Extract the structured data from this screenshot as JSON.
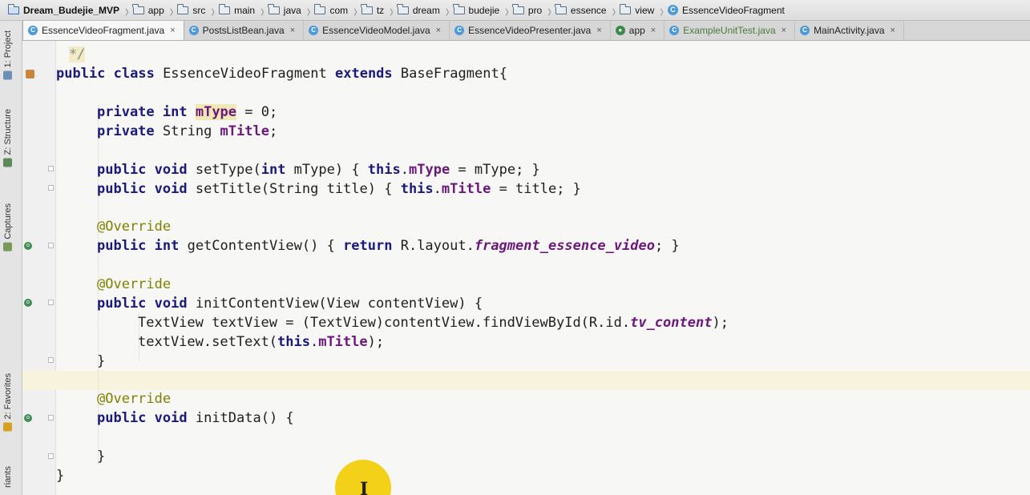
{
  "breadcrumb": [
    {
      "label": "Dream_Budejie_MVP",
      "icon": "project-folder-icon"
    },
    {
      "label": "app",
      "icon": "module-folder-icon"
    },
    {
      "label": "src",
      "icon": "folder-icon"
    },
    {
      "label": "main",
      "icon": "folder-icon"
    },
    {
      "label": "java",
      "icon": "folder-icon"
    },
    {
      "label": "com",
      "icon": "package-icon"
    },
    {
      "label": "tz",
      "icon": "package-icon"
    },
    {
      "label": "dream",
      "icon": "package-icon"
    },
    {
      "label": "budejie",
      "icon": "package-icon"
    },
    {
      "label": "pro",
      "icon": "package-icon"
    },
    {
      "label": "essence",
      "icon": "package-icon"
    },
    {
      "label": "view",
      "icon": "package-icon"
    },
    {
      "label": "EssenceVideoFragment",
      "icon": "class-icon"
    }
  ],
  "tabs": [
    {
      "label": "EssenceVideoFragment.java",
      "active": true
    },
    {
      "label": "PostsListBean.java"
    },
    {
      "label": "EssenceVideoModel.java"
    },
    {
      "label": "EssenceVideoPresenter.java"
    },
    {
      "label": "app"
    },
    {
      "label": "ExampleUnitTest.java"
    },
    {
      "label": "MainActivity.java"
    }
  ],
  "tab_close": "×",
  "tools": {
    "project": "1: Project",
    "structure": "Z: Structure",
    "captures": "Captures",
    "favorites": "2: Favorites",
    "variants": "riants"
  },
  "code": {
    "l0": "*/",
    "l1_kw": "public class",
    "l1_rest": " EssenceVideoFragment ",
    "l1_kw2": "extends",
    "l1_rest2": " BaseFragment{",
    "l2_kw": "private int",
    "l2_field": "mType",
    "l2_rest": " = 0;",
    "l3_kw": "private",
    "l3_rest": " String ",
    "l3_field": "mTitle",
    "l3_end": ";",
    "l4_kw": "public void",
    "l4_rest": " setType(",
    "l4_kw2": "int",
    "l4_rest2": " mType) { ",
    "l4_this": "this",
    "l4_dot": ".",
    "l4_field": "mType",
    "l4_end": " = mType; }",
    "l5_kw": "public void",
    "l5_rest": " setTitle(String title) { ",
    "l5_this": "this",
    "l5_dot": ".",
    "l5_field": "mTitle",
    "l5_end": " = title; }",
    "ann": "@Override",
    "l6_kw": "public int",
    "l6_rest": " getContentView() { ",
    "l6_ret": "return",
    "l6_rest2": " R.layout.",
    "l6_static": "fragment_essence_video",
    "l6_end": "; }",
    "l7_kw": "public void",
    "l7_rest": " initContentView(View contentView) {",
    "l8_rest": "TextView textView = (TextView)contentView.findViewById(R.id.",
    "l8_static": "tv_content",
    "l8_end": ");",
    "l9_rest": "textView.setText(",
    "l9_this": "this",
    "l9_dot": ".",
    "l9_field": "mTitle",
    "l9_end": ");",
    "close": "}",
    "l10_kw": "public void",
    "l10_rest": " initData() {"
  }
}
